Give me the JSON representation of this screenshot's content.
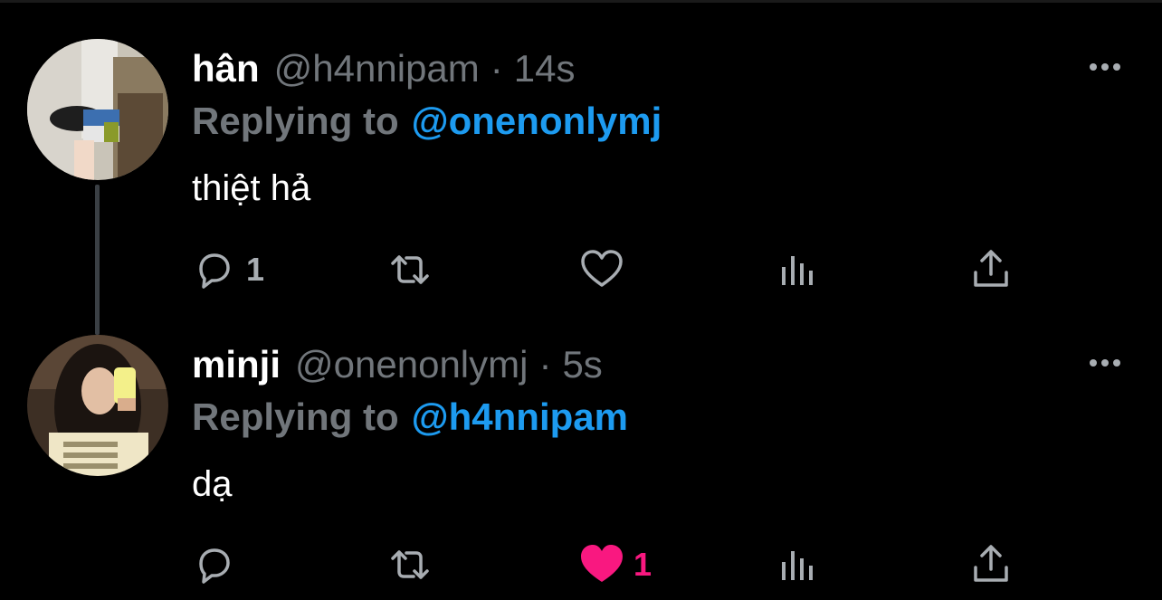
{
  "tweets": [
    {
      "display_name": "hân",
      "handle": "@h4nnipam",
      "separator": "·",
      "time": "14s",
      "replying_prefix": "Replying to",
      "replying_to": "@onenonlymj",
      "text": "thiệt hả",
      "reply_count": "1",
      "retweet_count": "",
      "like_count": "",
      "liked": false,
      "avatar_icon": "profile-photo"
    },
    {
      "display_name": "minji",
      "handle": "@onenonlymj",
      "separator": "·",
      "time": "5s",
      "replying_prefix": "Replying to",
      "replying_to": "@h4nnipam",
      "text": "dạ",
      "reply_count": "",
      "retweet_count": "",
      "like_count": "1",
      "liked": true,
      "avatar_icon": "profile-photo"
    }
  ],
  "colors": {
    "background": "#000000",
    "secondary_text": "#71767b",
    "link": "#1d9bf0",
    "like_active": "#f91880",
    "icon": "#a8adb2",
    "thread_line": "#3a3f44"
  },
  "icons": {
    "more": "more-horizontal-icon",
    "reply": "reply-bubble-icon",
    "retweet": "retweet-icon",
    "like": "heart-icon",
    "views": "views-bar-chart-icon",
    "share": "share-upload-icon"
  }
}
